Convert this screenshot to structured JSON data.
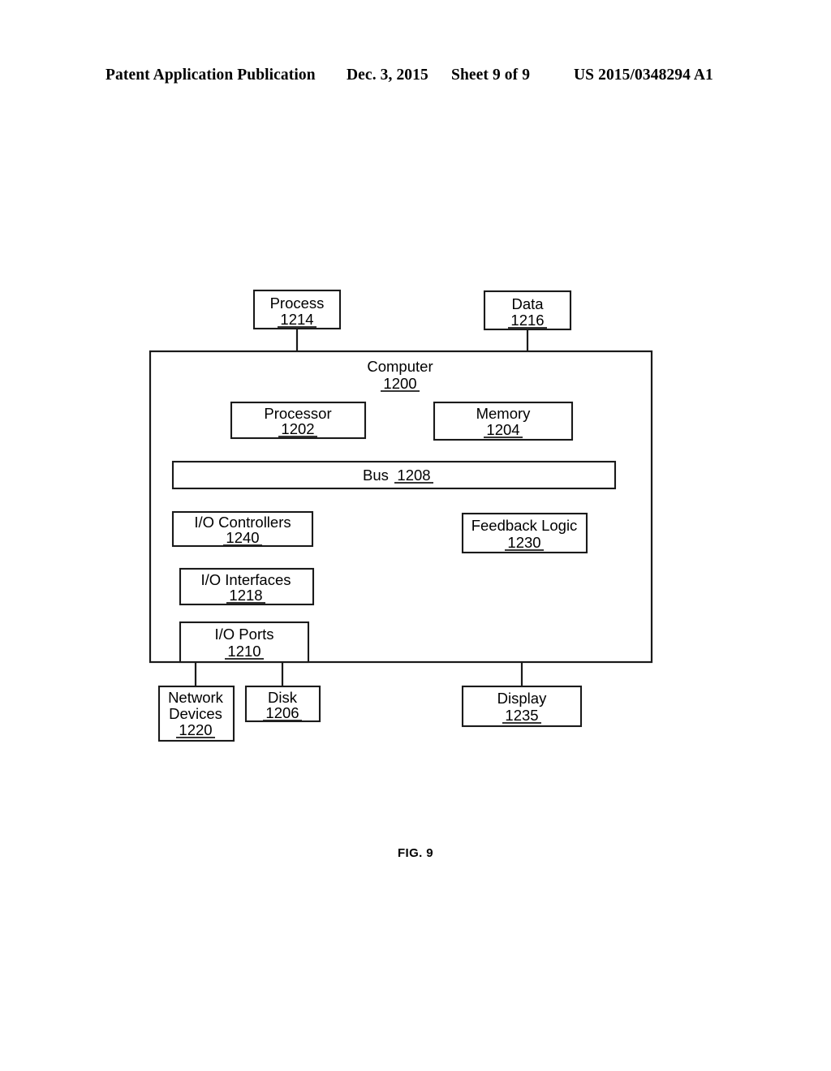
{
  "header": {
    "publication": "Patent Application Publication",
    "date": "Dec. 3, 2015",
    "sheet": "Sheet 9 of 9",
    "patent_number": "US 2015/0348294 A1"
  },
  "figure": {
    "caption": "FIG. 9"
  },
  "diagram": {
    "type": "block-diagram",
    "title": "Computer system block diagram",
    "nodes": {
      "process": {
        "label": "Process",
        "ref": "1214"
      },
      "data": {
        "label": "Data",
        "ref": "1216"
      },
      "computer": {
        "label": "Computer",
        "ref": "1200"
      },
      "processor": {
        "label": "Processor",
        "ref": "1202"
      },
      "memory": {
        "label": "Memory",
        "ref": "1204"
      },
      "bus": {
        "label": "Bus",
        "ref": "1208"
      },
      "io_controllers": {
        "label": "I/O Controllers",
        "ref": "1240"
      },
      "feedback_logic": {
        "label": "Feedback Logic",
        "ref": "1230"
      },
      "io_interfaces": {
        "label": "I/O Interfaces",
        "ref": "1218"
      },
      "io_ports": {
        "label": "I/O Ports",
        "ref": "1210"
      },
      "network_devices": {
        "label_line1": "Network",
        "label_line2": "Devices",
        "ref": "1220"
      },
      "disk": {
        "label": "Disk",
        "ref": "1206"
      },
      "display": {
        "label": "Display",
        "ref": "1235"
      }
    },
    "colors": {
      "stroke": "#1a1a1a",
      "fill": "#ffffff",
      "text": "#000000"
    }
  }
}
